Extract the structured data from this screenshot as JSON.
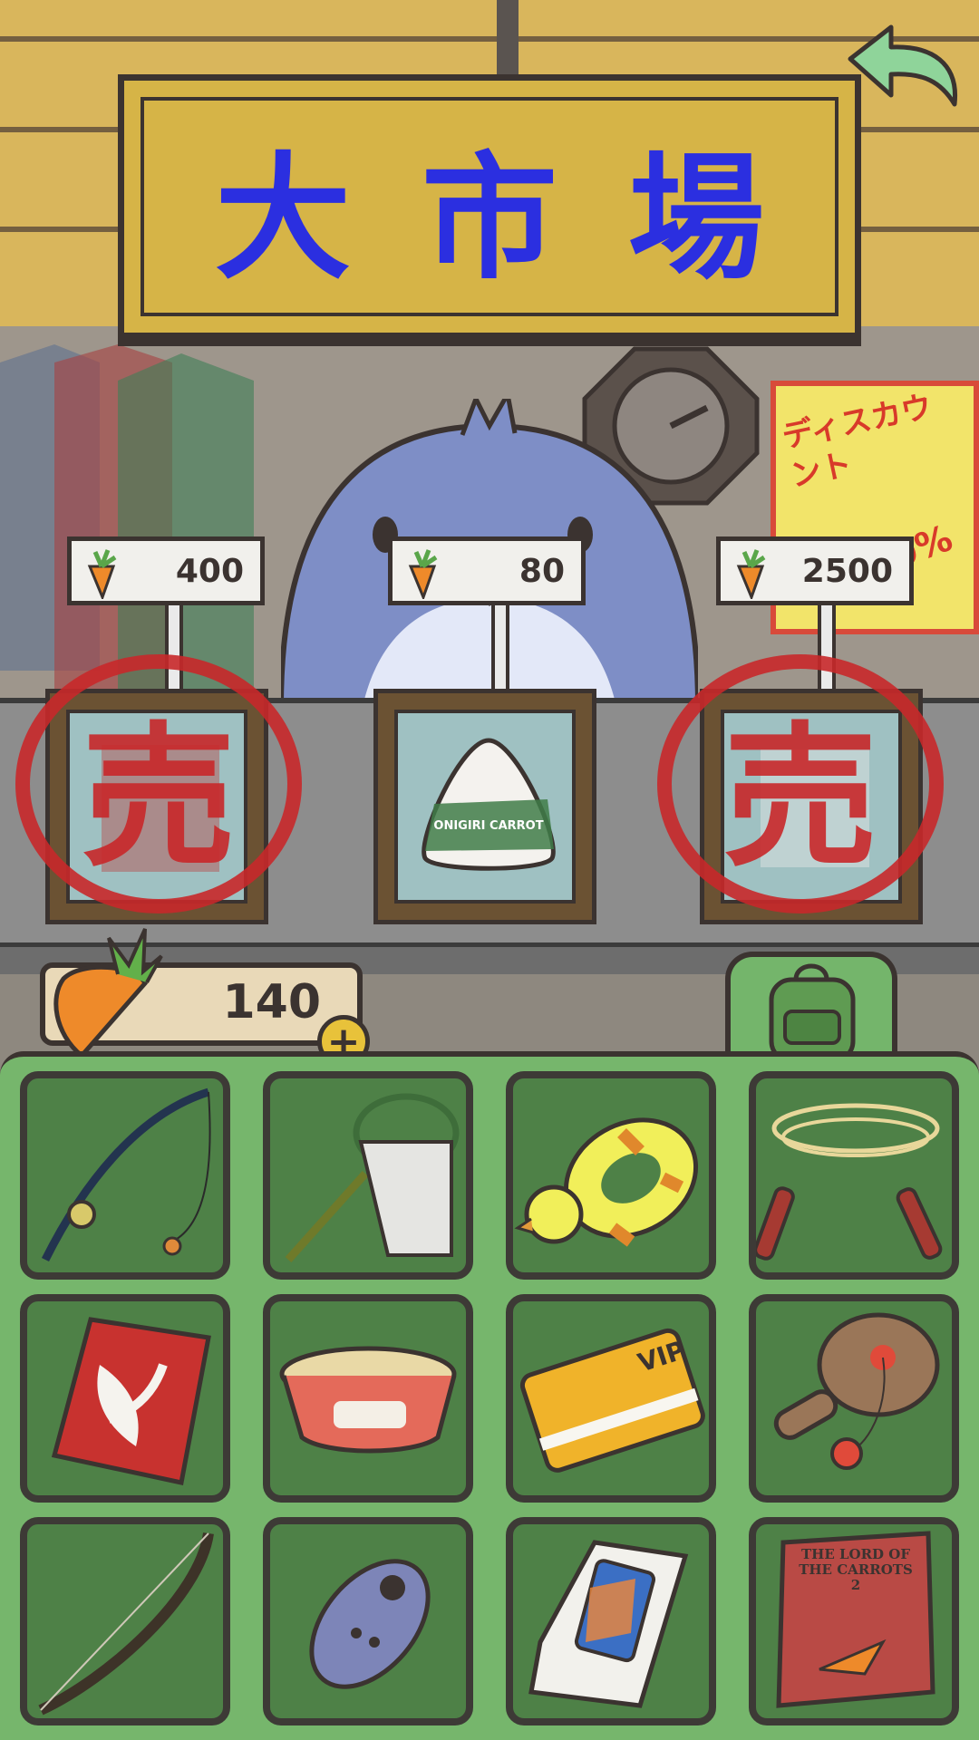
{
  "header": {
    "sign_title": "大市場",
    "back_icon": "back-arrow-icon"
  },
  "background": {
    "discount_poster": {
      "line1": "ディスカウント",
      "percent": "50%"
    }
  },
  "shop": {
    "items": [
      {
        "price": "400",
        "state": "sold",
        "sold_mark": "売",
        "icon": "book-icon"
      },
      {
        "price": "80",
        "state": "available",
        "icon": "onigiri-icon",
        "label": "ONIGIRI CARROT"
      },
      {
        "price": "2500",
        "state": "sold",
        "sold_mark": "売",
        "icon": "phone-box-icon"
      }
    ]
  },
  "wallet": {
    "carrot_count": "140",
    "add_label": "+"
  },
  "inventory": {
    "tab_icon": "backpack-icon",
    "slots": [
      {
        "name": "fishing-rod-icon"
      },
      {
        "name": "bug-net-icon"
      },
      {
        "name": "duck-float-icon"
      },
      {
        "name": "jump-rope-icon"
      },
      {
        "name": "kite-icon"
      },
      {
        "name": "cup-noodle-icon"
      },
      {
        "name": "vip-card-icon",
        "text": "VIP"
      },
      {
        "name": "paddle-ball-icon"
      },
      {
        "name": "bow-icon"
      },
      {
        "name": "remote-icon"
      },
      {
        "name": "phone-box-icon"
      },
      {
        "name": "book-icon",
        "text": "THE LORD OF THE CARROTS 2"
      }
    ]
  },
  "colors": {
    "sign_text": "#2b2fe0",
    "sold_stamp": "#c8282a",
    "inventory_bg": "#76b66c",
    "slot_bg": "#4e8147"
  }
}
